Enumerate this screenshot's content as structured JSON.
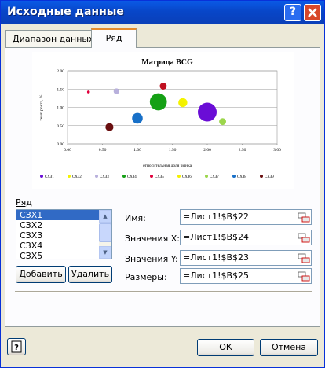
{
  "window": {
    "title": "Исходные данные",
    "help_button": "?",
    "close_button": "X"
  },
  "tabs": [
    {
      "label": "Диапазон данных",
      "active": false
    },
    {
      "label": "Ряд",
      "active": true
    }
  ],
  "chart_data": {
    "type": "scatter",
    "title": "Матрица BCG",
    "xlabel": "относительная доля рынка",
    "ylabel": "темп роста, %",
    "xlim": [
      0,
      3
    ],
    "ylim": [
      0,
      2
    ],
    "xticks": [
      "0.00",
      "0.50",
      "1.00",
      "1.50",
      "2.00",
      "2.50",
      "3.00"
    ],
    "yticks": [
      "0.00",
      "0.50",
      "1.00",
      "1.50",
      "2.00"
    ],
    "grid": true,
    "legend_position": "bottom",
    "series": [
      {
        "name": "СХЗ1",
        "color": "#6a0dd6",
        "x": 2.0,
        "y": 0.87,
        "size": 2.2
      },
      {
        "name": "СХЗ2",
        "color": "#f4f400",
        "x": 1.65,
        "y": 1.13,
        "size": 0.5
      },
      {
        "name": "СХЗ3",
        "color": "#b8b0dc",
        "x": 0.7,
        "y": 1.44,
        "size": 0.2
      },
      {
        "name": "СХЗ4",
        "color": "#15a015",
        "x": 1.3,
        "y": 1.15,
        "size": 1.8
      },
      {
        "name": "СХЗ5",
        "color": "#e0003c",
        "x": 0.3,
        "y": 1.42,
        "size": 0.05
      },
      {
        "name": "СХЗ6",
        "color": "#f4f000",
        "x": 1.63,
        "y": 1.1,
        "size": 0.15
      },
      {
        "name": "СХЗ7",
        "color": "#9cd64c",
        "x": 2.22,
        "y": 0.61,
        "size": 0.3
      },
      {
        "name": "СХЗ8",
        "color": "#1870c8",
        "x": 1.0,
        "y": 0.7,
        "size": 0.7
      },
      {
        "name": "СХЗ9",
        "color": "#6a0f10",
        "x": 0.6,
        "y": 0.46,
        "size": 0.4
      },
      {
        "name": "",
        "color": "#c01020",
        "x": 1.37,
        "y": 1.58,
        "size": 0.3
      }
    ]
  },
  "series_panel": {
    "group_label": "Ряд",
    "items": [
      "СЗХ1",
      "СЗХ2",
      "СЗХ3",
      "СЗХ4",
      "СЗХ5"
    ],
    "selected_index": 0,
    "add_button": "Добавить",
    "delete_button": "Удалить"
  },
  "fields": {
    "name": {
      "label": "Имя:",
      "value": "=Лист1!$B$22"
    },
    "x_values": {
      "label": "Значения X:",
      "value": "=Лист1!$B$24"
    },
    "y_values": {
      "label": "Значения Y:",
      "value": "=Лист1!$B$23"
    },
    "sizes": {
      "label": "Размеры:",
      "value": "=Лист1!$B$25"
    }
  },
  "footer": {
    "help_button": "?",
    "ok_button": "ОК",
    "cancel_button": "Отмена"
  },
  "colors": {
    "title_bar": "#0846c8",
    "selected_item": "#316ac5",
    "tab_highlight": "#e68b2c"
  }
}
